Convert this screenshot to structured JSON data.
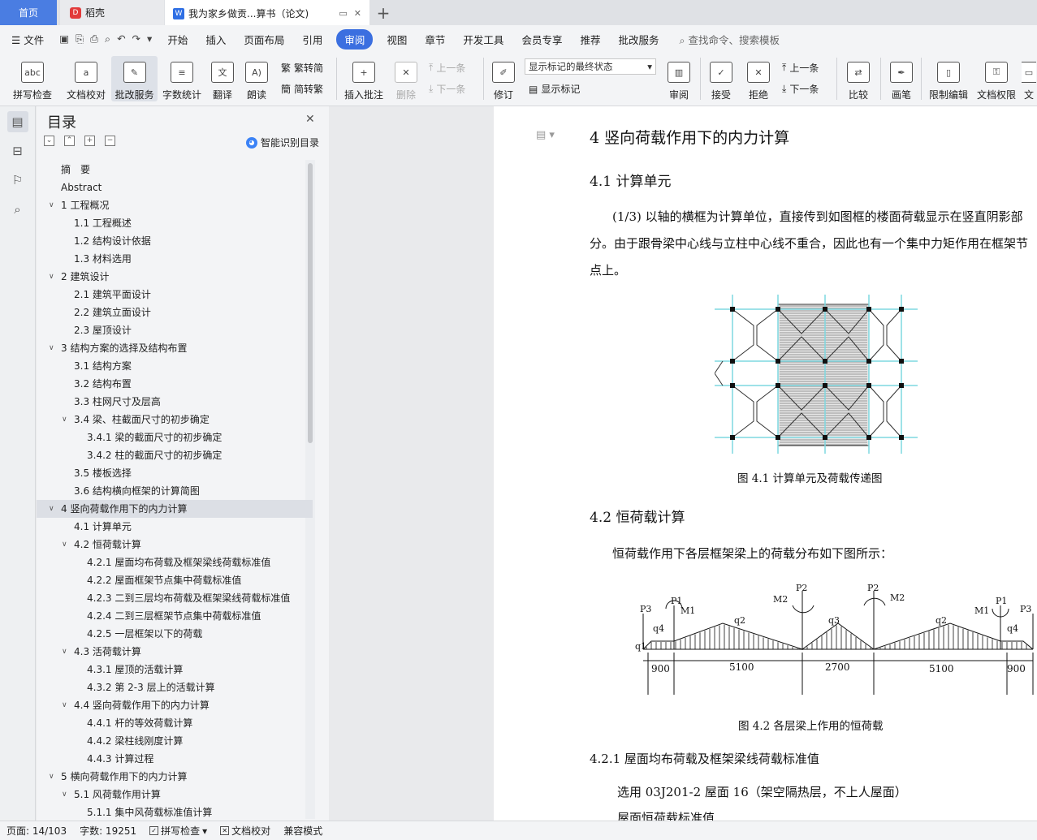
{
  "tabs": {
    "home": "首页",
    "daoke": "稻壳",
    "doc": "我为家乡做贡...算书（论文)"
  },
  "menu": {
    "file": "文件",
    "items": [
      "开始",
      "插入",
      "页面布局",
      "引用",
      "审阅",
      "视图",
      "章节",
      "开发工具",
      "会员专享",
      "推荐",
      "批改服务"
    ],
    "active_index": 4,
    "search": "查找命令、搜索模板"
  },
  "ribbon": {
    "spell": "拼写检查",
    "proof": "文档校对",
    "correct": "批改服务",
    "wordcount": "字数统计",
    "translate": "翻译",
    "read": "朗读",
    "trad": "繁转简",
    "simp": "简转繁",
    "insert_comment": "插入批注",
    "delete": "删除",
    "prev": "上一条",
    "next": "下一条",
    "revise": "修订",
    "state_select": "显示标记的最终状态",
    "show_marks": "显示标记",
    "review": "审阅",
    "accept": "接受",
    "reject": "拒绝",
    "prev2": "上一条",
    "next2": "下一条",
    "compare": "比较",
    "pen": "画笔",
    "restrict": "限制编辑",
    "perm": "文档权限",
    "more": "文"
  },
  "toc": {
    "title": "目录",
    "smart": "智能识别目录",
    "items": [
      {
        "t": "摘　要",
        "lv": 0,
        "arrow": false
      },
      {
        "t": "Abstract",
        "lv": 0,
        "arrow": false
      },
      {
        "t": "1  工程概况",
        "lv": 0,
        "arrow": true
      },
      {
        "t": "1.1 工程概述",
        "lv": 1,
        "arrow": false
      },
      {
        "t": "1.2 结构设计依据",
        "lv": 1,
        "arrow": false
      },
      {
        "t": "1.3 材料选用",
        "lv": 1,
        "arrow": false
      },
      {
        "t": "2  建筑设计",
        "lv": 0,
        "arrow": true
      },
      {
        "t": "2.1  建筑平面设计",
        "lv": 1,
        "arrow": false
      },
      {
        "t": "2.2  建筑立面设计",
        "lv": 1,
        "arrow": false
      },
      {
        "t": "2.3  屋顶设计",
        "lv": 1,
        "arrow": false
      },
      {
        "t": "3  结构方案的选择及结构布置",
        "lv": 0,
        "arrow": true
      },
      {
        "t": "3.1 结构方案",
        "lv": 1,
        "arrow": false
      },
      {
        "t": "3.2 结构布置",
        "lv": 1,
        "arrow": false
      },
      {
        "t": "3.3 柱网尺寸及层高",
        "lv": 1,
        "arrow": false
      },
      {
        "t": "3.4 梁、柱截面尺寸的初步确定",
        "lv": 1,
        "arrow": true
      },
      {
        "t": "3.4.1 梁的截面尺寸的初步确定",
        "lv": 2,
        "arrow": false
      },
      {
        "t": "3.4.2 柱的截面尺寸的初步确定",
        "lv": 2,
        "arrow": false
      },
      {
        "t": "3.5 楼板选择",
        "lv": 1,
        "arrow": false
      },
      {
        "t": "3.6 结构横向框架的计算简图",
        "lv": 1,
        "arrow": false
      },
      {
        "t": "4  竖向荷载作用下的内力计算",
        "lv": 0,
        "arrow": true
      },
      {
        "t": "4.1 计算单元",
        "lv": 1,
        "arrow": false
      },
      {
        "t": "4.2 恒荷载计算",
        "lv": 1,
        "arrow": true
      },
      {
        "t": "4.2.1 屋面均布荷载及框架梁线荷载标准值",
        "lv": 2,
        "arrow": false
      },
      {
        "t": "4.2.2 屋面框架节点集中荷载标准值",
        "lv": 2,
        "arrow": false
      },
      {
        "t": "4.2.3  二到三层均布荷载及框架梁线荷载标准值",
        "lv": 2,
        "arrow": false
      },
      {
        "t": "4.2.4 二到三层框架节点集中荷载标准值",
        "lv": 2,
        "arrow": false
      },
      {
        "t": "4.2.5 一层框架以下的荷载",
        "lv": 2,
        "arrow": false
      },
      {
        "t": "4.3 活荷载计算",
        "lv": 1,
        "arrow": true
      },
      {
        "t": "4.3.1 屋顶的活载计算",
        "lv": 2,
        "arrow": false
      },
      {
        "t": "4.3.2 第 2-3 层上的活载计算",
        "lv": 2,
        "arrow": false
      },
      {
        "t": "4.4 竖向荷载作用下的内力计算",
        "lv": 1,
        "arrow": true
      },
      {
        "t": "4.4.1 杆的等效荷载计算",
        "lv": 2,
        "arrow": false
      },
      {
        "t": "4.4.2 梁柱线刚度计算",
        "lv": 2,
        "arrow": false
      },
      {
        "t": "4.4.3 计算过程",
        "lv": 2,
        "arrow": false
      },
      {
        "t": "5  横向荷载作用下的内力计算",
        "lv": 0,
        "arrow": true
      },
      {
        "t": "5.1 风荷载作用计算",
        "lv": 1,
        "arrow": true
      },
      {
        "t": "5.1.1 集中风荷载标准值计算",
        "lv": 2,
        "arrow": false
      }
    ],
    "selected_index": 19
  },
  "doc": {
    "h1": "4  竖向荷载作用下的内力计算",
    "h41": "4.1 计算单元",
    "p41": "(1/3) 以轴的横框为计算单位，直接传到如图框的楼面荷载显示在竖直阴影部分。由于跟骨梁中心线与立柱中心线不重合，因此也有一个集中力矩作用在框架节点上。",
    "fig1": "图 4.1 计算单元及荷载传递图",
    "h42": "4.2 恒荷载计算",
    "p42": "恒荷载作用下各层框架梁上的荷载分布如下图所示：",
    "fig2": "图 4.2 各层梁上作用的恒荷载",
    "h421": "4.2.1 屋面均布荷载及框架梁线荷载标准值",
    "p421": "选用 03J201-2  屋面 16（架空隔热层，不上人屋面）",
    "p421b": "屋面恒荷载标准值",
    "diagram": {
      "labels": [
        "P3",
        "q4",
        "P1",
        "M1",
        "q2",
        "M2",
        "P2",
        "P2",
        "M2",
        "q3",
        "q2",
        "M1",
        "P1",
        "q4",
        "P3",
        "q1"
      ],
      "dims": [
        "900",
        "5100",
        "2700",
        "5100",
        "900"
      ]
    }
  },
  "status": {
    "page": "页面: 14/103",
    "words": "字数: 19251",
    "spell": "拼写检查",
    "proof": "文档校对",
    "compat": "兼容模式"
  }
}
